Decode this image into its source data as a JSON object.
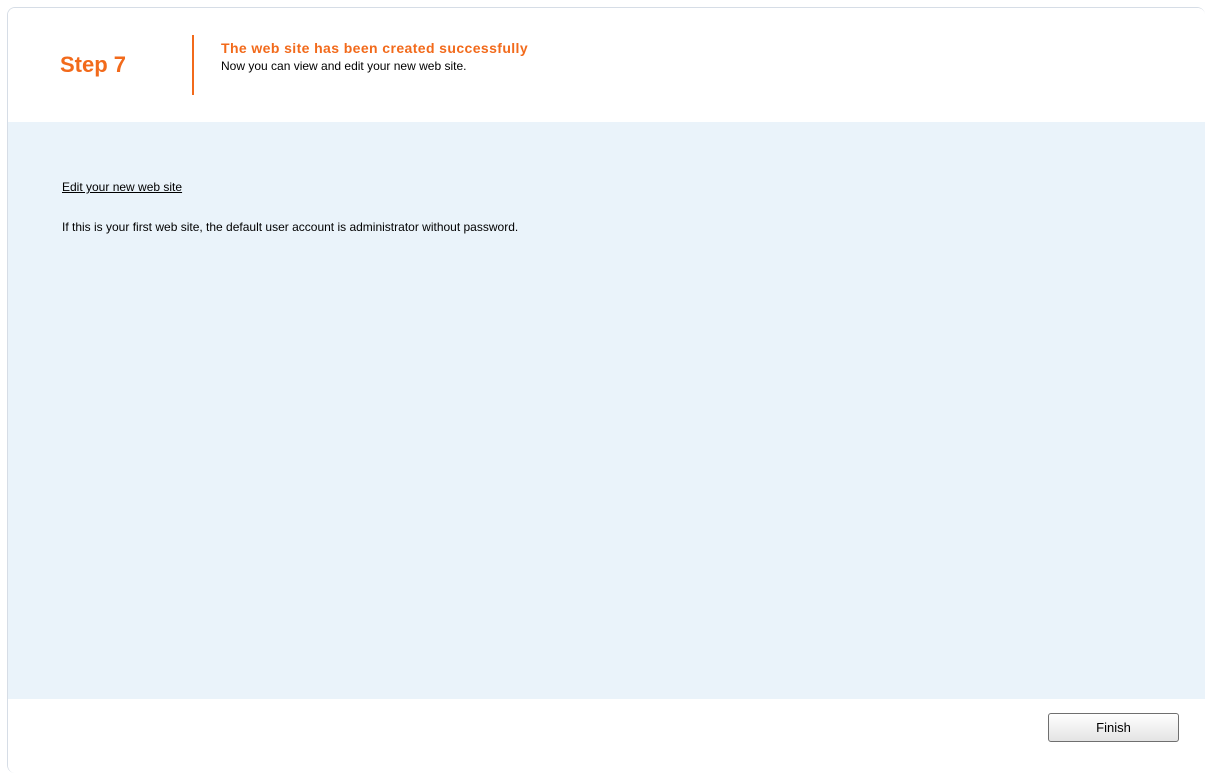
{
  "header": {
    "step": "Step 7",
    "title": "The web site has been created successfully",
    "subtitle": "Now you can view and edit your new web site."
  },
  "content": {
    "edit_link": "Edit your new web site",
    "info_text": "If this is your first web site, the default user account is administrator without password."
  },
  "footer": {
    "finish_label": "Finish"
  },
  "colors": {
    "accent": "#f26a1b",
    "content_background": "#eaf3fa"
  }
}
